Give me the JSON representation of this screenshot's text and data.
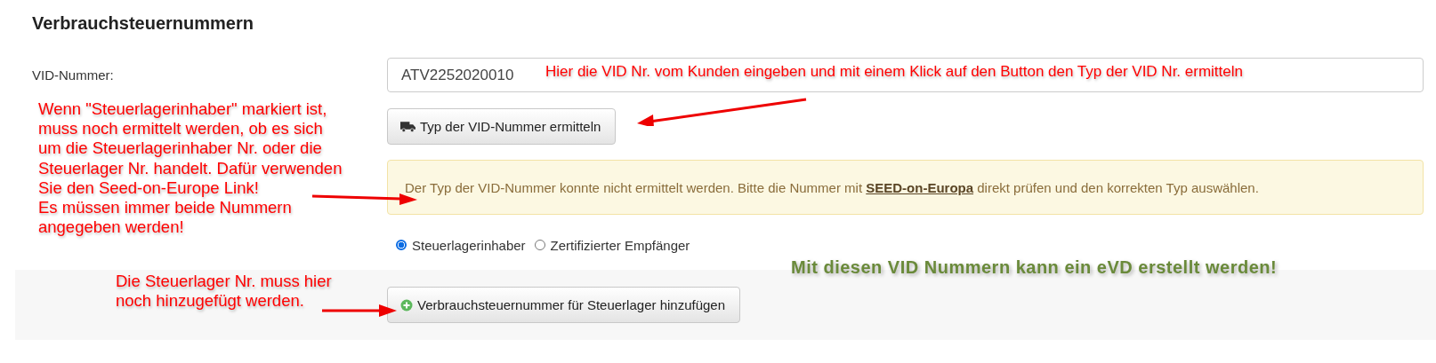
{
  "section": {
    "title": "Verbrauchsteuernummern"
  },
  "vid_field": {
    "label": "VID-Nummer:",
    "value": "ATV2252020010"
  },
  "lookup_button": {
    "label": "Typ der VID-Nummer ermitteln"
  },
  "alert": {
    "before": "Der Typ der VID-Nummer konnte nicht ermittelt werden. Bitte die Nummer mit",
    "link": "SEED-on-Europa",
    "after": "direkt prüfen und den korrekten Typ auswählen."
  },
  "radios": [
    {
      "label": "Steuerlagerinhaber",
      "selected": true
    },
    {
      "label": "Zertifizierter Empfänger",
      "selected": false
    }
  ],
  "add_button": {
    "label": "Verbrauchsteuernummer für Steuerlager hinzufügen"
  },
  "annotations": [
    {
      "kind": "instruction",
      "text": "Hier die VID Nr. vom Kunden eingeben und mit einem Klick auf den Button den Typ der VID Nr. ermitteln"
    },
    {
      "kind": "instruction",
      "text": "Wenn \"Steuerlagerinhaber\" markiert ist,\nmuss noch ermittelt werden, ob es sich\num die Steuerlagerinhaber Nr. oder die\nSteuerlager Nr. handelt. Dafür verwenden\nSie den Seed-on-Europe Link!\nEs müssen immer beide Nummern\nangegeben werden!"
    },
    {
      "kind": "instruction",
      "text": "Die Steuerlager Nr. muss hier\nnoch hinzugefügt werden."
    },
    {
      "kind": "remark",
      "text": "Mit diesen VID Nummern kann ein eVD erstellt werden!"
    }
  ]
}
